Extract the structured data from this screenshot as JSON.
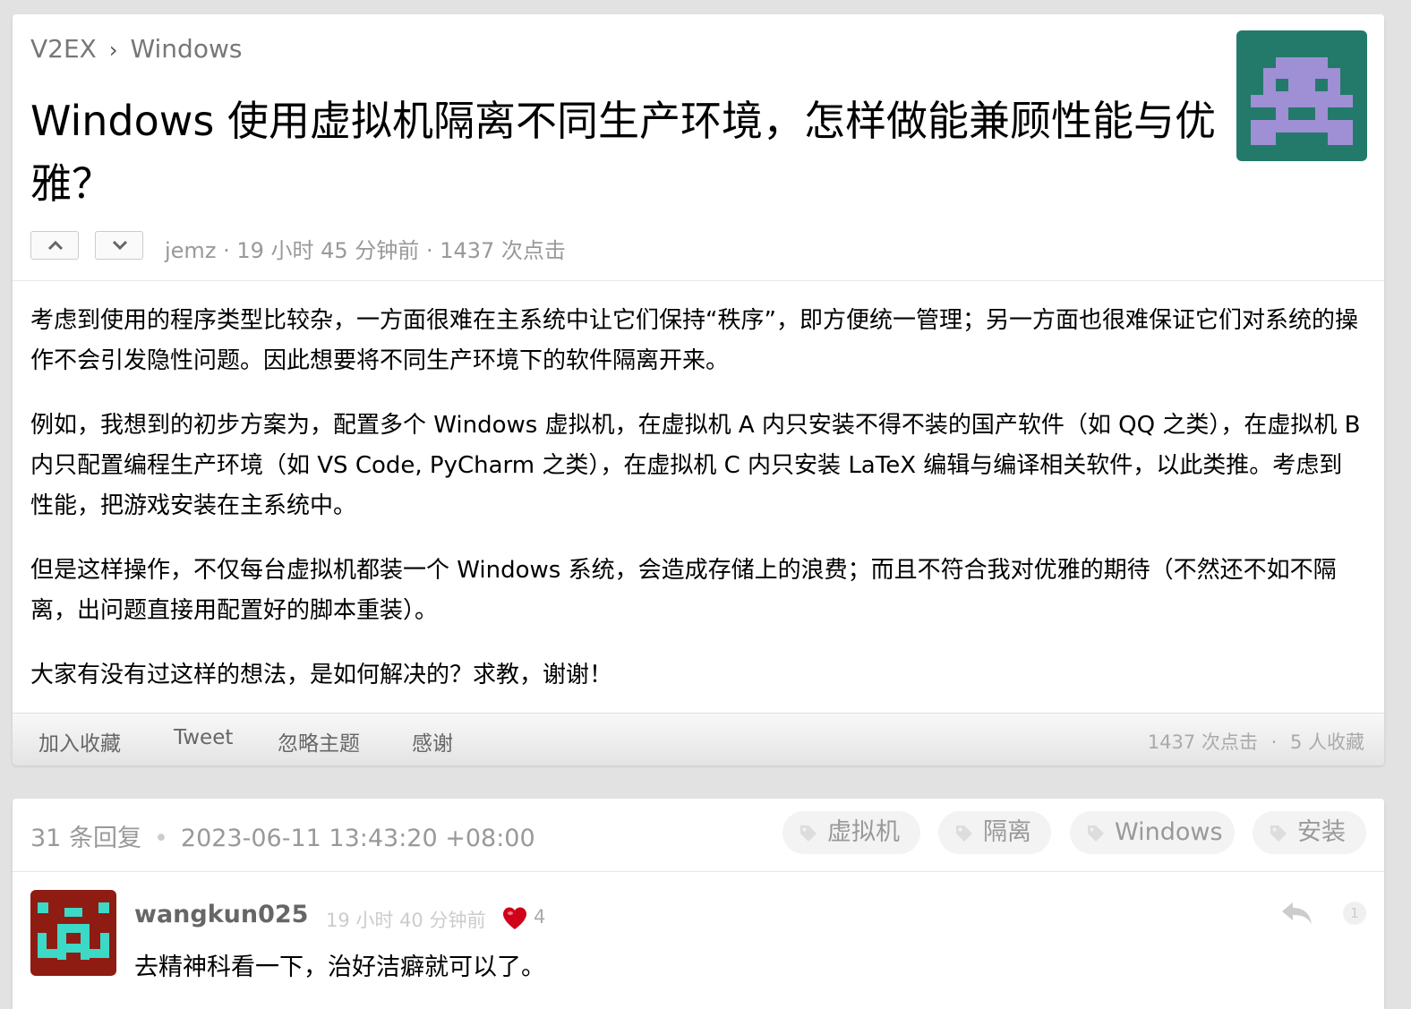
{
  "breadcrumb": {
    "site": "V2EX",
    "separator": "›",
    "node": "Windows"
  },
  "topic": {
    "title": "Windows 使用虚拟机隔离不同生产环境，怎样做能兼顾性能与优雅？",
    "author": "jemz",
    "time_ago": "19 小时 45 分钟前",
    "clicks": "1437 次点击",
    "paragraphs": [
      "考虑到使用的程序类型比较杂，一方面很难在主系统中让它们保持“秩序”，即方便统一管理；另一方面也很难保证它们对系统的操作不会引发隐性问题。因此想要将不同生产环境下的软件隔离开来。",
      "例如，我想到的初步方案为，配置多个 Windows 虚拟机，在虚拟机 A 内只安装不得不装的国产软件（如 QQ 之类），在虚拟机 B 内只配置编程生产环境（如 VS Code, PyCharm 之类），在虚拟机 C 内只安装 LaTeX 编辑与编译相关软件，以此类推。考虑到性能，把游戏安装在主系统中。",
      "但是这样操作，不仅每台虚拟机都装一个 Windows 系统，会造成存储上的浪费；而且不符合我对优雅的期待（不然还不如不隔离，出问题直接用配置好的脚本重装）。",
      "大家有没有过这样的想法，是如何解决的？求教，谢谢！"
    ]
  },
  "footer": {
    "actions": [
      "加入收藏",
      "Tweet",
      "忽略主题",
      "感谢"
    ],
    "clicks": "1437 次点击",
    "separator": "·",
    "favorites": "5 人收藏"
  },
  "replies": {
    "count": "31 条回复",
    "separator": "•",
    "date": "2023-06-11 13:43:20 +08:00",
    "tags": [
      "虚拟机",
      "隔离",
      "Windows",
      "安装"
    ]
  },
  "reply1": {
    "username": "wangkun025",
    "time_ago": "19 小时 40 分钟前",
    "likes": "4",
    "text": "去精神科看一下，治好洁癖就可以了。",
    "floor": "1"
  },
  "colors": {
    "background": "#e2e2e2",
    "avatar_topic_bg": "#237a6a",
    "avatar_topic_fg": "#9f8fd4",
    "avatar_reply_bg": "#8f1c13",
    "avatar_reply_fg": "#3cd9c6",
    "heart": "#d0021b"
  },
  "icons": [
    "upvote-icon",
    "downvote-icon",
    "tag-icon",
    "heart-icon",
    "reply-icon"
  ]
}
